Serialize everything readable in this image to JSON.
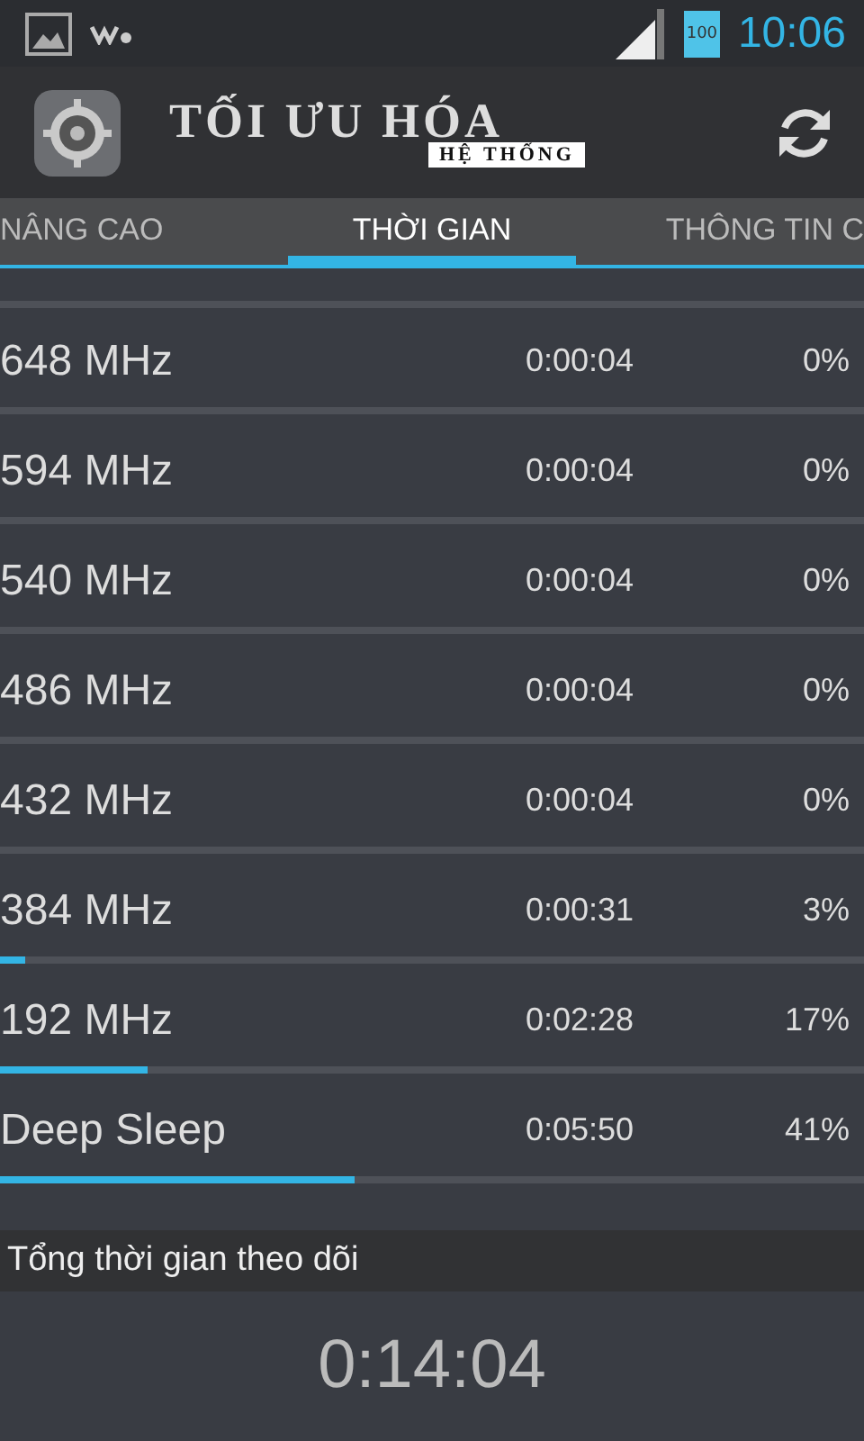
{
  "status_bar": {
    "battery": "100",
    "time": "10:06"
  },
  "header": {
    "title": "TỐI ƯU HÓA",
    "subtitle": "HỆ THỐNG"
  },
  "tabs": [
    {
      "label": "NÂNG CAO",
      "selected": false
    },
    {
      "label": "THỜI GIAN",
      "selected": true
    },
    {
      "label": "THÔNG TIN C",
      "selected": false
    }
  ],
  "rows": [
    {
      "frequency": "648 MHz",
      "time": "0:00:04",
      "percent": "0%",
      "level": 0
    },
    {
      "frequency": "594 MHz",
      "time": "0:00:04",
      "percent": "0%",
      "level": 0
    },
    {
      "frequency": "540 MHz",
      "time": "0:00:04",
      "percent": "0%",
      "level": 0
    },
    {
      "frequency": "486 MHz",
      "time": "0:00:04",
      "percent": "0%",
      "level": 0
    },
    {
      "frequency": "432 MHz",
      "time": "0:00:04",
      "percent": "0%",
      "level": 0
    },
    {
      "frequency": "384 MHz",
      "time": "0:00:31",
      "percent": "3%",
      "level": 0.03
    },
    {
      "frequency": "192 MHz",
      "time": "0:02:28",
      "percent": "17%",
      "level": 0.17
    },
    {
      "frequency": "Deep Sleep",
      "time": "0:05:50",
      "percent": "41%",
      "level": 0.41
    }
  ],
  "footer": {
    "label": "Tổng thời gian theo dõi",
    "total": "0:14:04"
  }
}
